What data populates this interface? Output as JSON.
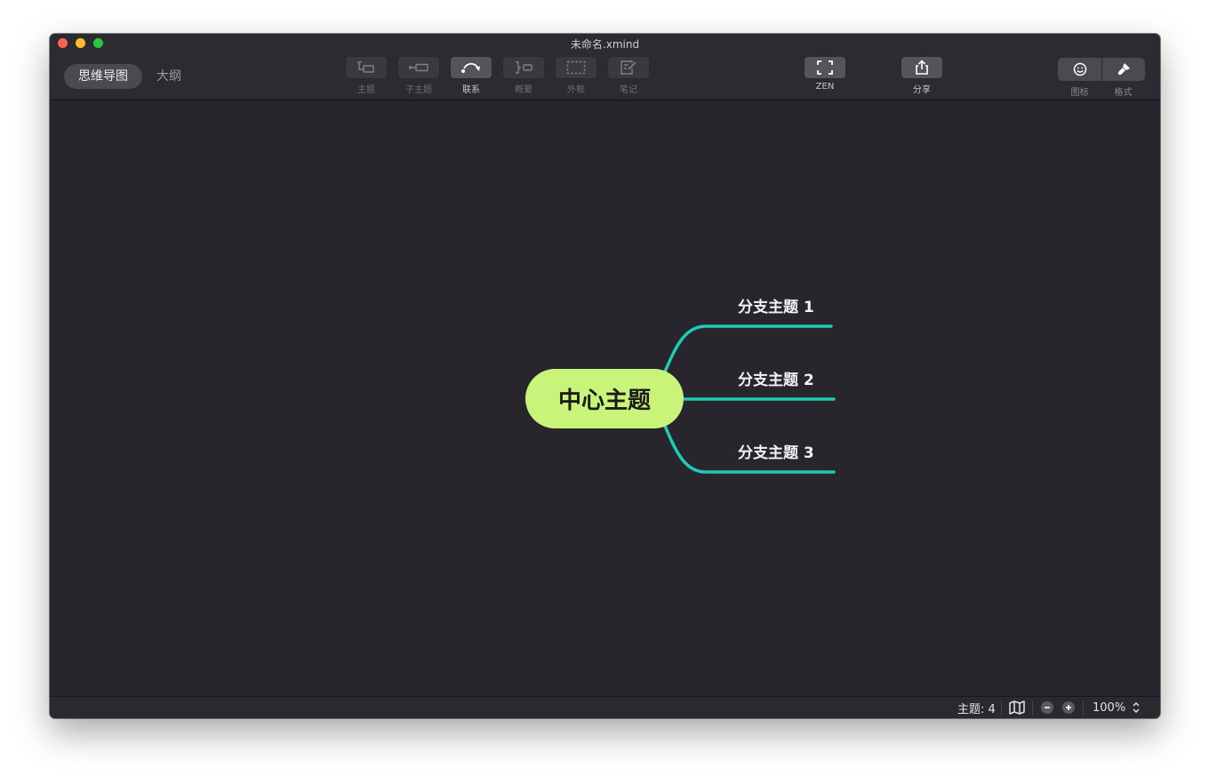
{
  "window": {
    "title": "未命名.xmind"
  },
  "view_switch": {
    "mindmap_label": "思维导图",
    "outline_label": "大纲"
  },
  "toolbar": {
    "topic_label": "主题",
    "subtopic_label": "子主题",
    "relationship_label": "联系",
    "summary_label": "概要",
    "boundary_label": "外框",
    "notes_label": "笔记",
    "zen_label": "ZEN",
    "share_label": "分享",
    "icon_label": "图标",
    "format_label": "格式"
  },
  "mindmap": {
    "central_topic": "中心主题",
    "branches": [
      {
        "label": "分支主题 1"
      },
      {
        "label": "分支主题 2"
      },
      {
        "label": "分支主题 3"
      }
    ],
    "colors": {
      "central_fill": "#c9f47a",
      "branch_line": "#1ecbb5",
      "canvas_bg": "#28252d"
    }
  },
  "statusbar": {
    "topic_count": "主题: 4",
    "zoom": "100%"
  },
  "icons": {
    "topic": "topic-icon",
    "subtopic": "subtopic-icon",
    "relationship": "relationship-icon",
    "summary": "summary-icon",
    "boundary": "boundary-icon",
    "notes": "notes-icon",
    "zen": "fullscreen-icon",
    "share": "share-icon",
    "icon_panel": "smiley-icon",
    "format_panel": "paintbrush-icon",
    "map": "map-icon",
    "zoom_out": "minus-icon",
    "zoom_in": "plus-icon",
    "zoom_stepper": "chevron-up-down-icon"
  }
}
